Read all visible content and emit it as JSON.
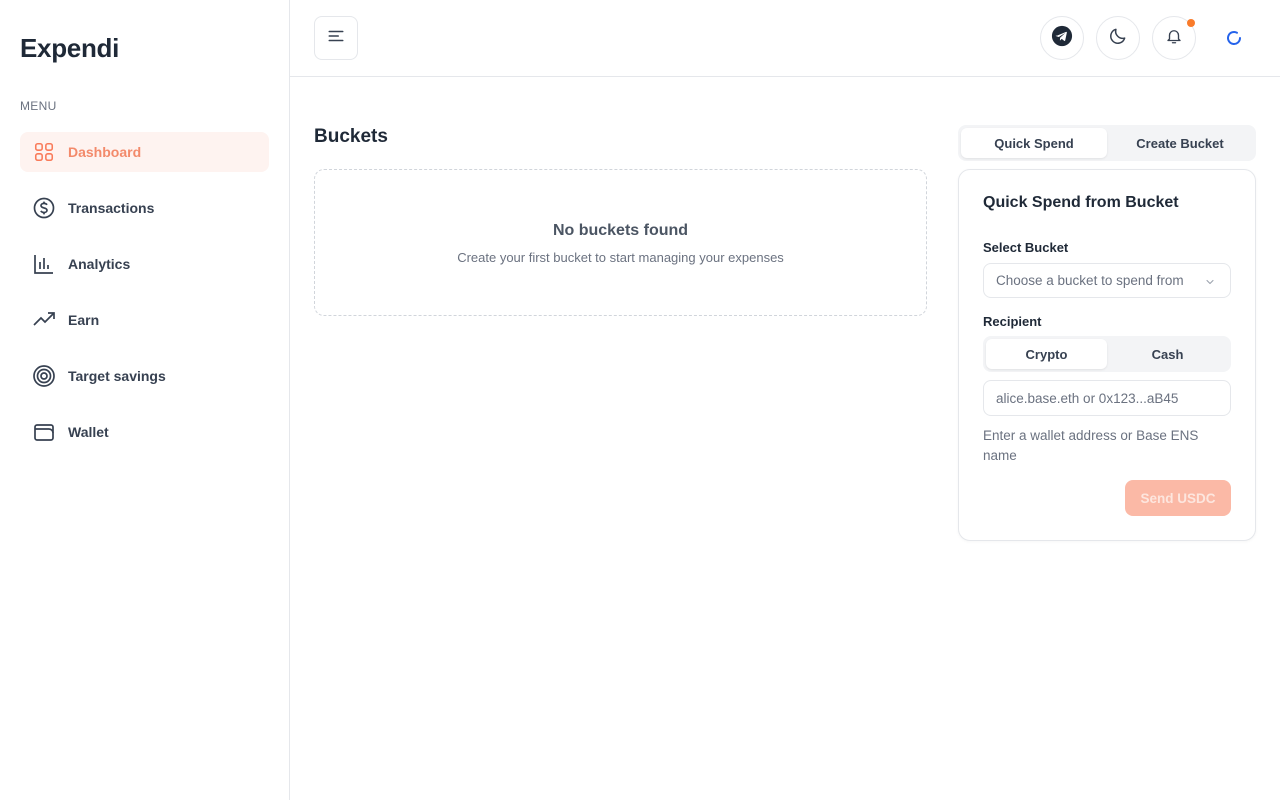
{
  "brand": "Expendi",
  "sidebar": {
    "menu_label": "MENU",
    "items": [
      {
        "label": "Dashboard",
        "icon": "dashboard-icon"
      },
      {
        "label": "Transactions",
        "icon": "dollar-circle-icon"
      },
      {
        "label": "Analytics",
        "icon": "bar-chart-icon"
      },
      {
        "label": "Earn",
        "icon": "trending-up-icon"
      },
      {
        "label": "Target savings",
        "icon": "target-icon"
      },
      {
        "label": "Wallet",
        "icon": "wallet-icon"
      }
    ],
    "active_index": 0
  },
  "header": {
    "icons": [
      "menu-icon",
      "telegram-icon",
      "moon-icon",
      "bell-icon",
      "spinner-icon"
    ],
    "notification_dot": true
  },
  "buckets": {
    "title": "Buckets",
    "empty_title": "No buckets found",
    "empty_subtitle": "Create your first bucket to start managing your expenses"
  },
  "tabs": {
    "items": [
      "Quick Spend",
      "Create Bucket"
    ],
    "active": "Quick Spend"
  },
  "quick_spend": {
    "title": "Quick Spend from Bucket",
    "select_label": "Select Bucket",
    "select_placeholder": "Choose a bucket to spend from",
    "recipient_label": "Recipient",
    "recipient_tabs": [
      "Crypto",
      "Cash"
    ],
    "recipient_active": "Crypto",
    "address_placeholder": "alice.base.eth or 0x123...aB45",
    "address_value": "",
    "hint": "Enter a wallet address or Base ENS name",
    "send_label": "Send USDC",
    "send_disabled": true
  },
  "colors": {
    "accent": "#f97b5a",
    "accent_light_bg": "#fef3f0",
    "send_disabled_bg": "#fbb9a6",
    "notification_dot": "#f97b2a",
    "spinner": "#2563eb"
  }
}
